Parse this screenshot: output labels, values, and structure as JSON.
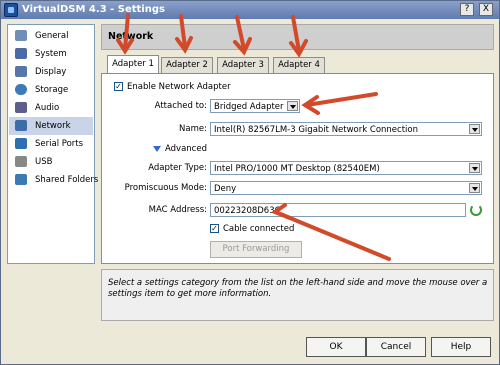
{
  "window": {
    "title": "VirtualDSM 4.3 - Settings",
    "help_glyph": "?",
    "close_glyph": "X"
  },
  "sidebar": {
    "items": [
      {
        "label": "General",
        "icon": "monitor-icon",
        "color": "#6f8fb9"
      },
      {
        "label": "System",
        "icon": "chip-icon",
        "color": "#4a6aa8"
      },
      {
        "label": "Display",
        "icon": "display-icon",
        "color": "#5577aa"
      },
      {
        "label": "Storage",
        "icon": "disk-icon",
        "color": "#3f7ab8"
      },
      {
        "label": "Audio",
        "icon": "speaker-icon",
        "color": "#5e5e8c"
      },
      {
        "label": "Network",
        "icon": "network-icon",
        "color": "#3b6ea8"
      },
      {
        "label": "Serial Ports",
        "icon": "serial-icon",
        "color": "#2d6fb3"
      },
      {
        "label": "USB",
        "icon": "usb-icon",
        "color": "#888888"
      },
      {
        "label": "Shared Folders",
        "icon": "folder-icon",
        "color": "#3d79b3"
      }
    ]
  },
  "main": {
    "heading": "Network",
    "tabs": [
      "Adapter 1",
      "Adapter 2",
      "Adapter 3",
      "Adapter 4"
    ],
    "enable_adapter": {
      "label": "Enable Network Adapter",
      "checked": true
    },
    "attached_to": {
      "label": "Attached to:",
      "value": "Bridged Adapter"
    },
    "name": {
      "label": "Name:",
      "value": "Intel(R) 82567LM-3 Gigabit Network Connection"
    },
    "advanced": "Advanced",
    "adapter_type": {
      "label": "Adapter Type:",
      "value": "Intel PRO/1000 MT Desktop (82540EM)"
    },
    "promiscuous": {
      "label": "Promiscuous Mode:",
      "value": "Deny"
    },
    "mac": {
      "label": "MAC Address:",
      "value": "00223208D63C"
    },
    "cable": {
      "label": "Cable connected",
      "checked": true
    },
    "port_forwarding": "Port Forwarding"
  },
  "info": "Select a settings category from the list on the left-hand side and move the mouse over a settings item to get more information.",
  "buttons": {
    "ok": "OK",
    "cancel": "Cancel",
    "help": "Help"
  },
  "colors": {
    "annotation_arrow": "#d24a2a",
    "accent": "#2f6ad2"
  }
}
